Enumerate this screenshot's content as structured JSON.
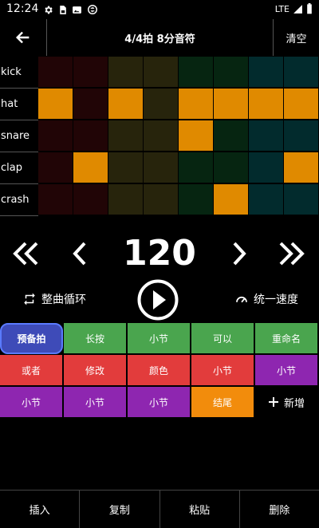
{
  "status": {
    "time": "12:24",
    "network": "LTE"
  },
  "topbar": {
    "title": "4/4拍 8分音符",
    "clear_label": "清空"
  },
  "grid": {
    "rows": [
      {
        "label": "kick",
        "cells": [
          0,
          0,
          0,
          0,
          0,
          0,
          0,
          0
        ]
      },
      {
        "label": "hat",
        "cells": [
          1,
          0,
          1,
          0,
          1,
          1,
          1,
          1
        ]
      },
      {
        "label": "snare",
        "cells": [
          0,
          0,
          0,
          0,
          1,
          0,
          0,
          0
        ]
      },
      {
        "label": "clap",
        "cells": [
          0,
          1,
          0,
          0,
          0,
          0,
          0,
          1
        ]
      },
      {
        "label": "crash",
        "cells": [
          0,
          0,
          0,
          0,
          0,
          1,
          0,
          0
        ]
      }
    ],
    "column_colors": [
      "#210506",
      "#210506",
      "#27240c",
      "#27240c",
      "#062511",
      "#062511",
      "#022b2d",
      "#022b2d"
    ],
    "active_color": "#e08a00"
  },
  "tempo": {
    "bpm": "120"
  },
  "controls": {
    "loop_label": "整曲循环",
    "speed_label": "统一速度"
  },
  "chips": [
    {
      "label": "预备拍",
      "color": "#3e4bb8",
      "active": true
    },
    {
      "label": "长按",
      "color": "#4aa54e"
    },
    {
      "label": "小节",
      "color": "#4aa54e"
    },
    {
      "label": "可以",
      "color": "#4aa54e"
    },
    {
      "label": "重命名",
      "color": "#4aa54e"
    },
    {
      "label": "或者",
      "color": "#e23c3c"
    },
    {
      "label": "修改",
      "color": "#e23c3c"
    },
    {
      "label": "颜色",
      "color": "#e23c3c"
    },
    {
      "label": "小节",
      "color": "#e23c3c"
    },
    {
      "label": "小节",
      "color": "#8e26b0"
    },
    {
      "label": "小节",
      "color": "#8e26b0"
    },
    {
      "label": "小节",
      "color": "#8e26b0"
    },
    {
      "label": "小节",
      "color": "#8e26b0"
    },
    {
      "label": "结尾",
      "color": "#f28c0c"
    }
  ],
  "add_label": "新增",
  "bottom": {
    "insert": "插入",
    "copy": "复制",
    "paste": "粘贴",
    "delete": "删除"
  }
}
